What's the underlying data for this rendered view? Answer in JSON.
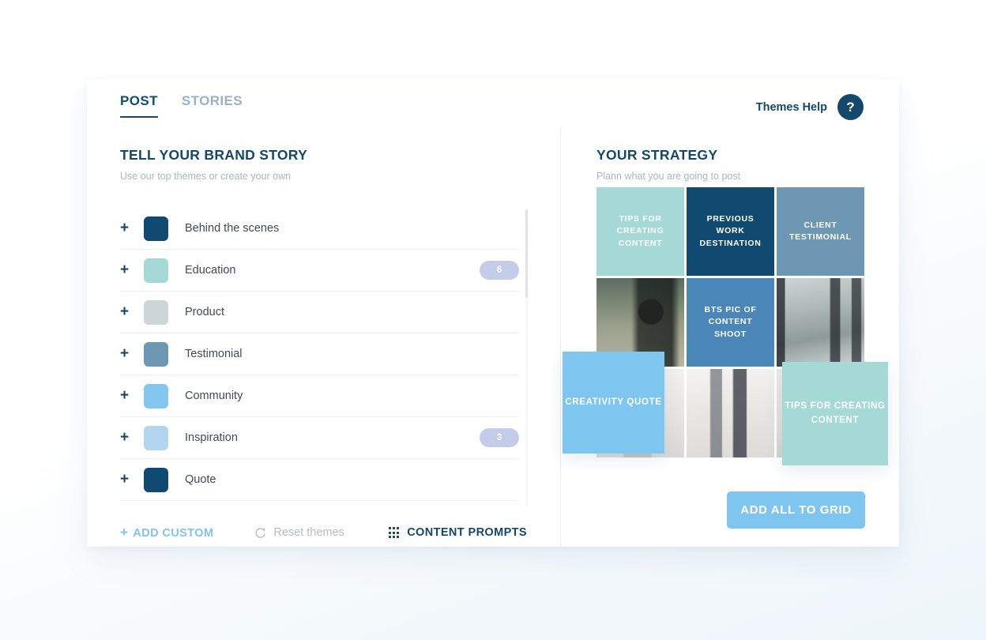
{
  "tabs": [
    {
      "label": "POST",
      "active": true
    },
    {
      "label": "STORIES",
      "active": false
    }
  ],
  "help": {
    "label": "Themes Help",
    "icon": "?"
  },
  "left_panel": {
    "title": "TELL YOUR BRAND STORY",
    "subtitle": "Use our top themes or create your own",
    "themes": [
      {
        "label": "Behind the scenes",
        "color": "#104a70",
        "badge": ""
      },
      {
        "label": "Education",
        "color": "#a5d9d6",
        "badge": "6"
      },
      {
        "label": "Product",
        "color": "#ccd6d8",
        "badge": ""
      },
      {
        "label": "Testimonial",
        "color": "#6e97b4",
        "badge": ""
      },
      {
        "label": "Community",
        "color": "#83c6f0",
        "badge": ""
      },
      {
        "label": "Inspiration",
        "color": "#b2d6ef",
        "badge": "3"
      },
      {
        "label": "Quote",
        "color": "#104a70",
        "badge": ""
      }
    ],
    "actions": {
      "add_custom": "ADD CUSTOM",
      "add_custom_glyph": "+",
      "reset": "Reset themes",
      "reset_icon": "refresh-icon",
      "prompts": "CONTENT PROMPTS",
      "prompts_icon": "grid-dots-icon"
    }
  },
  "right_panel": {
    "title": "YOUR STRATEGY",
    "subtitle": "Plann what you are going to post",
    "grid": [
      {
        "label": "TIPS FOR CREATING CONTENT",
        "color": "#a5d9d6",
        "type": "color"
      },
      {
        "label": "PREVIOUS WORK DESTINATION",
        "color": "#104a70",
        "type": "color"
      },
      {
        "label": "CLIENT TESTIMONIAL",
        "color": "#6e97b4",
        "type": "color"
      },
      {
        "label": "",
        "color": "#8a8276",
        "type": "photo"
      },
      {
        "label": "BTS PIC OF CONTENT SHOOT",
        "color": "#4a86b8",
        "type": "color"
      },
      {
        "label": "",
        "color": "#a8afb2",
        "type": "photo"
      },
      {
        "label": "",
        "color": "#f1f0ee",
        "type": "photo"
      },
      {
        "label": "",
        "color": "#e7e6e4",
        "type": "photo"
      },
      {
        "label": "",
        "color": "#dfdedc",
        "type": "photo"
      }
    ],
    "floating": [
      {
        "label": "CREATIVITY QUOTE",
        "color": "#7ec5f0"
      },
      {
        "label": "TIPS FOR CREATING CONTENT",
        "color": "#a5d9d6"
      }
    ],
    "add_all_button": "ADD ALL TO GRID"
  }
}
